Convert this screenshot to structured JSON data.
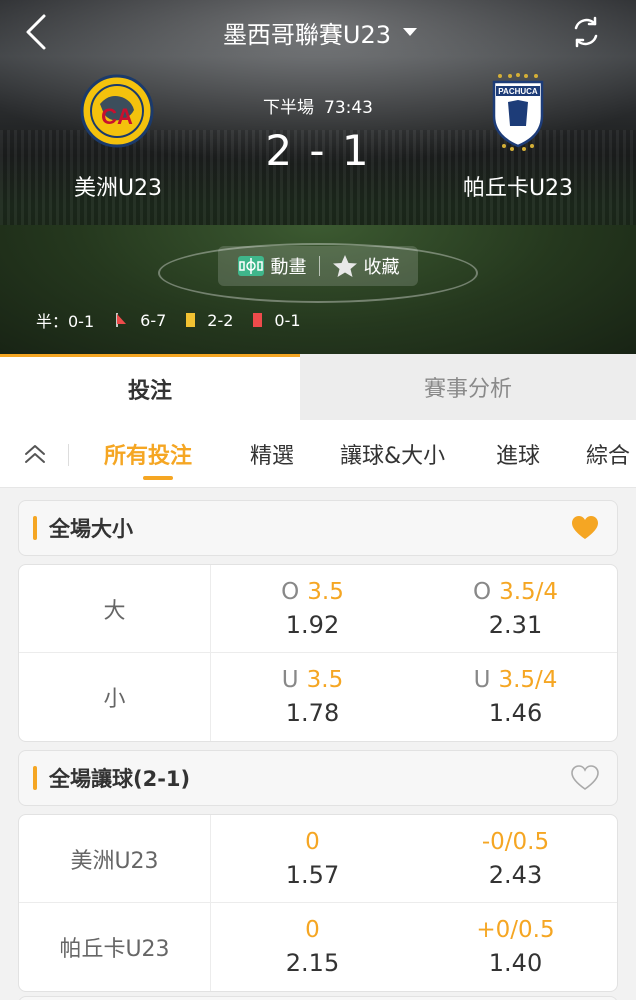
{
  "header": {
    "league": "墨西哥聯賽U23",
    "period": "下半場",
    "clock": "73:43",
    "score": "2 - 1",
    "home_team": "美洲U23",
    "away_team": "帕丘卡U23",
    "away_logo_text": "PACHUCA",
    "actions": {
      "animation": "動畫",
      "favorite": "收藏"
    },
    "stats": {
      "half": "半：0-1",
      "corners": "6-7",
      "yellow": "2-2",
      "red": "0-1"
    }
  },
  "main_tabs": [
    "投注",
    "賽事分析"
  ],
  "sub_tabs": [
    "所有投注",
    "精選",
    "讓球&大小",
    "進球",
    "綜合"
  ],
  "colors": {
    "accent": "#f5a623",
    "text": "#333333",
    "muted": "#888888"
  },
  "sections": [
    {
      "title": "全場大小",
      "favorited": true,
      "rows": [
        {
          "label": "大",
          "cells": [
            {
              "prefix": "O",
              "line": "3.5",
              "price": "1.92"
            },
            {
              "prefix": "O",
              "line": "3.5/4",
              "price": "2.31"
            }
          ]
        },
        {
          "label": "小",
          "cells": [
            {
              "prefix": "U",
              "line": "3.5",
              "price": "1.78"
            },
            {
              "prefix": "U",
              "line": "3.5/4",
              "price": "1.46"
            }
          ]
        }
      ]
    },
    {
      "title": "全場讓球(2-1)",
      "favorited": false,
      "rows": [
        {
          "label": "美洲U23",
          "cells": [
            {
              "prefix": "",
              "line": "0",
              "price": "1.57"
            },
            {
              "prefix": "",
              "line": "-0/0.5",
              "price": "2.43"
            }
          ]
        },
        {
          "label": "帕丘卡U23",
          "cells": [
            {
              "prefix": "",
              "line": "0",
              "price": "2.15"
            },
            {
              "prefix": "",
              "line": "+0/0.5",
              "price": "1.40"
            }
          ]
        }
      ]
    }
  ]
}
